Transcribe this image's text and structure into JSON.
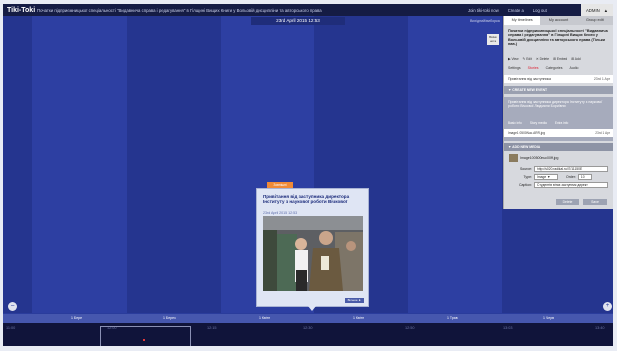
{
  "app": {
    "logo": "Tiki-Toki"
  },
  "header": {
    "timeline_title": "Початки підприємницької спеціальності \"Видавнича справа і редагування\" в Гілщині Вищих Книги у Вольовій дисципліни та авторського права",
    "links": [
      "Join tiki-toki now",
      "Create a",
      "Log out"
    ],
    "admin_button": "ADMIN",
    "admin_arrow": "▲"
  },
  "timeline": {
    "current_date": "23rd April 2015 12:53",
    "view_menu": "Вихідний/виборка",
    "view_badge": "Ввімк нота",
    "months": [
      "1 Бере",
      "1 Берез",
      "1 Квітн",
      "1 Квітн",
      "1 Трав",
      "1 Черв"
    ],
    "years": [
      "11:00",
      "12:00",
      "12:15",
      "12:30",
      "12:50",
      "13:03",
      "13:20",
      "13:40"
    ]
  },
  "story": {
    "tab": "Зовнішні",
    "title": "Привітання від заступника директора Інституту з наукової роботи Вічкової",
    "date": "23rd April 2015 12:53",
    "more_button": "Більше ►"
  },
  "admin_panel": {
    "tabs": [
      "My timelines",
      "My account",
      "Group edit"
    ],
    "timeline_title": "Початки підприємницької спеціальності \"Видавнича справа і редагування\" в Гілщині Вищих Книги у Вольовій дисципліни та авторського права (Тільки нав.)",
    "actions": [
      "▶ View",
      "✎ Edit",
      "✕ Delete",
      "⊞ Embed",
      "⊞ Add"
    ],
    "subtabs": [
      "Settings",
      "Stories",
      "Categories",
      "Audio"
    ],
    "event_row": {
      "label": "Привітання від заступника",
      "date": "23rd 1 Apr"
    },
    "create_event": "▼ CREATE NEW EVENT",
    "story_block": {
      "title": "Привітання від заступника директора Інституту з наукової роботи Вічкової Людмили Бориївни",
      "labels": [
        "Basic info",
        "Story media",
        "Extra info"
      ],
      "image_row": "Image1 0500Nuc.ARR.jpg",
      "image_date": "23rd 1 Apr"
    },
    "create_media": "▼ ADD NEW MEDIA",
    "media_file": "Image100500нuc00ff.jpg",
    "form": {
      "source_label": "Source:",
      "source_value": "http://s020.radikal.ru/i7/11150E",
      "type_label": "Type:",
      "type_value": "Image ▼",
      "order_label": "Order:",
      "order_value": "10",
      "caption_label": "Caption:",
      "caption_value": "Студентів вітає заступник директ"
    },
    "cancel_button": "Delete",
    "save_button": "Save"
  },
  "controls": {
    "zoom_out": "−",
    "zoom_in": "+"
  },
  "colors": {
    "background": "#2a3c9c",
    "column_dark": "#25358f",
    "column_light": "#2d3fa2",
    "top_bar": "#151c44",
    "accent": "#f08a36"
  }
}
